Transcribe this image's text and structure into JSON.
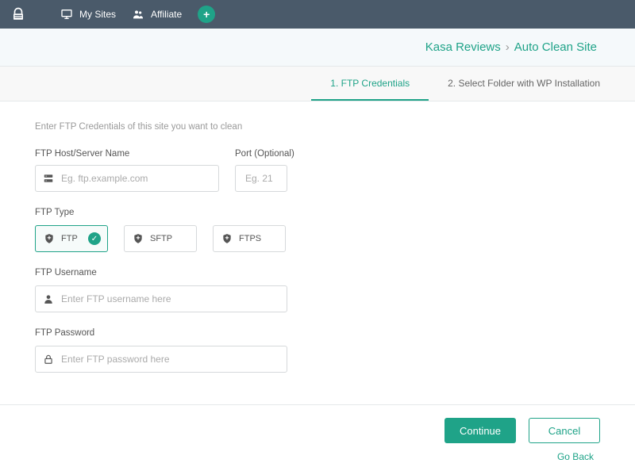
{
  "nav": {
    "my_sites": "My Sites",
    "affiliate": "Affiliate"
  },
  "breadcrumb": {
    "site": "Kasa Reviews",
    "sep": "›",
    "page": "Auto Clean Site"
  },
  "steps": {
    "s1": "1. FTP Credentials",
    "s2": "2. Select Folder with WP Installation"
  },
  "form": {
    "intro": "Enter FTP Credentials of this site you want to clean",
    "host_label": "FTP Host/Server Name",
    "host_placeholder": "Eg. ftp.example.com",
    "host_value": "",
    "port_label": "Port (Optional)",
    "port_placeholder": "Eg. 21",
    "port_value": "",
    "type_label": "FTP Type",
    "types": {
      "ftp": "FTP",
      "sftp": "SFTP",
      "ftps": "FTPS"
    },
    "username_label": "FTP Username",
    "username_placeholder": "Enter FTP username here",
    "username_value": "",
    "password_label": "FTP Password",
    "password_placeholder": "Enter FTP password here",
    "password_value": ""
  },
  "footer": {
    "continue": "Continue",
    "cancel": "Cancel",
    "go_back": "Go Back"
  },
  "colors": {
    "accent": "#1fa388",
    "navbg": "#4a5a6a"
  }
}
